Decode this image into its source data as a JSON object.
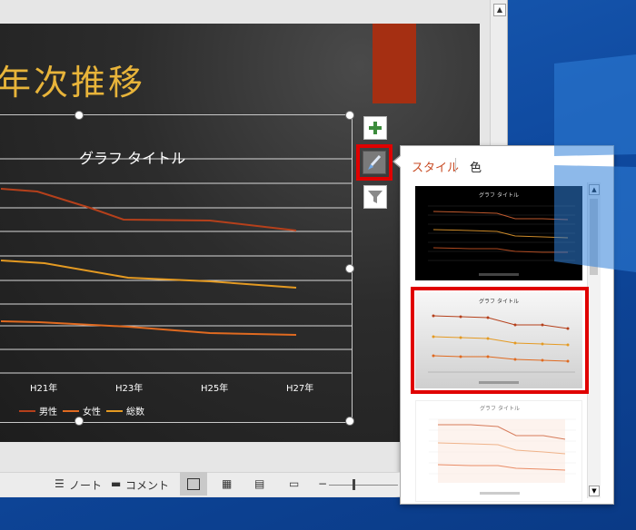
{
  "slide": {
    "title": "年次推移"
  },
  "chart": {
    "title": "グラフ タイトル",
    "type": "line",
    "x_labels": [
      "H21年",
      "H23年",
      "H25年",
      "H27年"
    ],
    "legend": [
      "男性",
      "女性",
      "総数"
    ],
    "colors": {
      "男性": "#b5401b",
      "女性": "#e06a20",
      "総数": "#e49a22"
    }
  },
  "chart_buttons": {
    "add_icon": "plus-icon",
    "style_icon": "brush-icon",
    "filter_icon": "funnel-icon"
  },
  "statusbar": {
    "notes": "ノート",
    "comments": "コメント",
    "zoom_minus": "−"
  },
  "style_pane": {
    "tabs": [
      "スタイル",
      "色"
    ],
    "thumbnails": [
      {
        "title": "グラフ タイトル",
        "theme": "dark"
      },
      {
        "title": "グラフ タイトル",
        "theme": "light-gradient",
        "selected": true
      },
      {
        "title": "グラフ タイトル",
        "theme": "white"
      }
    ]
  }
}
